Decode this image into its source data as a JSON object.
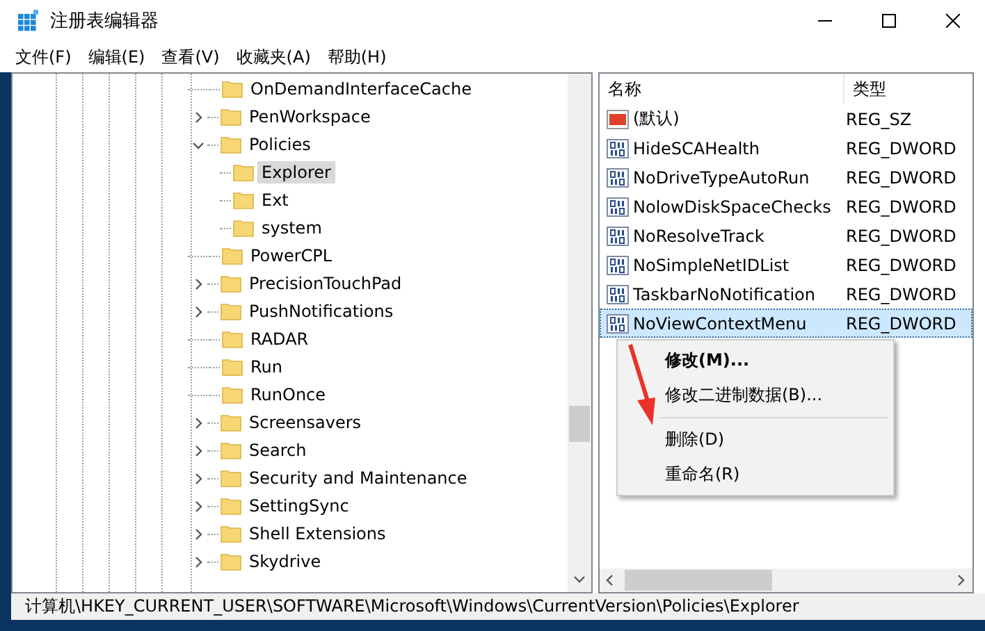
{
  "window": {
    "title": "注册表编辑器"
  },
  "menu": [
    "文件(F)",
    "编辑(E)",
    "查看(V)",
    "收藏夹(A)",
    "帮助(H)"
  ],
  "tree": [
    {
      "label": "OnDemandInterfaceCache",
      "kind": "leaf",
      "expanded": false,
      "selected": false
    },
    {
      "label": "PenWorkspace",
      "kind": "branch",
      "expanded": false,
      "selected": false
    },
    {
      "label": "Policies",
      "kind": "branch",
      "expanded": true,
      "selected": false,
      "children": [
        {
          "label": "Explorer",
          "selected": true
        },
        {
          "label": "Ext",
          "selected": false
        },
        {
          "label": "system",
          "selected": false
        }
      ]
    },
    {
      "label": "PowerCPL",
      "kind": "leaf",
      "expanded": false,
      "selected": false
    },
    {
      "label": "PrecisionTouchPad",
      "kind": "branch",
      "expanded": false,
      "selected": false
    },
    {
      "label": "PushNotifications",
      "kind": "branch",
      "expanded": false,
      "selected": false
    },
    {
      "label": "RADAR",
      "kind": "leaf",
      "expanded": false,
      "selected": false
    },
    {
      "label": "Run",
      "kind": "leaf",
      "expanded": false,
      "selected": false
    },
    {
      "label": "RunOnce",
      "kind": "leaf",
      "expanded": false,
      "selected": false
    },
    {
      "label": "Screensavers",
      "kind": "branch",
      "expanded": false,
      "selected": false
    },
    {
      "label": "Search",
      "kind": "branch",
      "expanded": false,
      "selected": false
    },
    {
      "label": "Security and Maintenance",
      "kind": "branch",
      "expanded": false,
      "selected": false
    },
    {
      "label": "SettingSync",
      "kind": "branch",
      "expanded": false,
      "selected": false
    },
    {
      "label": "Shell Extensions",
      "kind": "branch",
      "expanded": false,
      "selected": false
    },
    {
      "label": "Skydrive",
      "kind": "branch",
      "expanded": false,
      "selected": false
    }
  ],
  "values": {
    "columns": [
      "名称",
      "类型"
    ],
    "rows": [
      {
        "name": "(默认)",
        "type": "REG_SZ",
        "kind": "string",
        "selected": false
      },
      {
        "name": "HideSCAHealth",
        "type": "REG_DWORD",
        "kind": "dword",
        "selected": false
      },
      {
        "name": "NoDriveTypeAutoRun",
        "type": "REG_DWORD",
        "kind": "dword",
        "selected": false
      },
      {
        "name": "NolowDiskSpaceChecks",
        "type": "REG_DWORD",
        "kind": "dword",
        "selected": false
      },
      {
        "name": "NoResolveTrack",
        "type": "REG_DWORD",
        "kind": "dword",
        "selected": false
      },
      {
        "name": "NoSimpleNetIDList",
        "type": "REG_DWORD",
        "kind": "dword",
        "selected": false
      },
      {
        "name": "TaskbarNoNotification",
        "type": "REG_DWORD",
        "kind": "dword",
        "selected": false
      },
      {
        "name": "NoViewContextMenu",
        "type": "REG_DWORD",
        "kind": "dword",
        "selected": true
      }
    ]
  },
  "context_menu": [
    {
      "label": "修改(M)...",
      "default": true,
      "separator_before": false
    },
    {
      "label": "修改二进制数据(B)...",
      "default": false,
      "separator_before": false
    },
    {
      "label": "删除(D)",
      "default": false,
      "separator_before": true
    },
    {
      "label": "重命名(R)",
      "default": false,
      "separator_before": false
    }
  ],
  "status_bar": "计算机\\HKEY_CURRENT_USER\\SOFTWARE\\Microsoft\\Windows\\CurrentVersion\\Policies\\Explorer"
}
